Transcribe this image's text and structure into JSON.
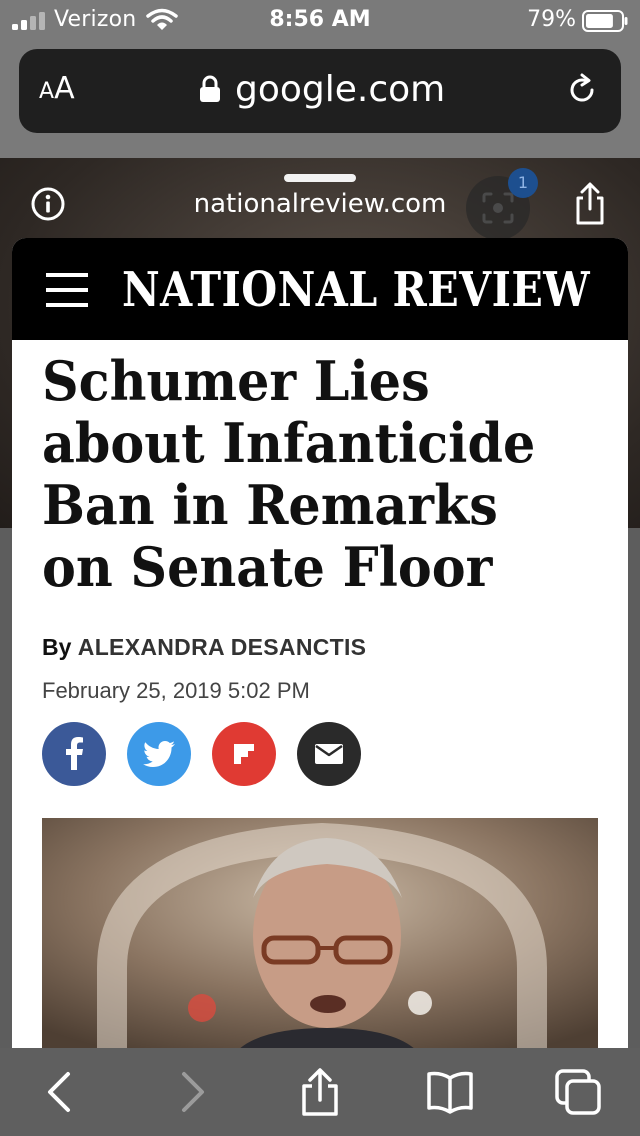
{
  "status_bar": {
    "carrier": "Verizon",
    "time": "8:56 AM",
    "battery_percent": "79%",
    "battery_level": 0.79,
    "icons": [
      "signal-icon",
      "wifi-icon",
      "battery-icon"
    ]
  },
  "browser": {
    "text_size_small": "A",
    "text_size_large": "A",
    "address": "google.com",
    "icons": [
      "lock-icon",
      "reload-icon"
    ]
  },
  "sheet": {
    "domain": "nationalreview.com",
    "badge_count": "1",
    "icons": [
      "info-icon",
      "scan-icon",
      "share-icon"
    ]
  },
  "article": {
    "site_name": "NATIONAL REVIEW",
    "headline": "Schumer Lies about Infanticide Ban in Remarks on Senate Floor",
    "byline_prefix": "By",
    "author": "ALEXANDRA DESANCTIS",
    "date": "February 25, 2019 5:02 PM",
    "share_buttons": [
      {
        "icon": "facebook-icon",
        "color": "#3b5998"
      },
      {
        "icon": "twitter-icon",
        "color": "#3d9ae8"
      },
      {
        "icon": "flipboard-icon",
        "color": "#e03a33"
      },
      {
        "icon": "email-icon",
        "color": "#2a2a2a"
      }
    ]
  },
  "toolbar": {
    "icons": [
      "back-icon",
      "forward-icon",
      "share-icon",
      "bookmarks-icon",
      "tabs-icon"
    ]
  }
}
